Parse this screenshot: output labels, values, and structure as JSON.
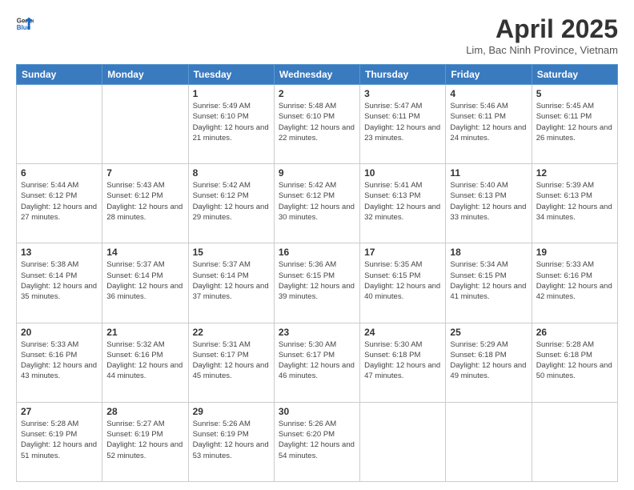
{
  "header": {
    "logo_line1": "General",
    "logo_line2": "Blue",
    "title": "April 2025",
    "subtitle": "Lim, Bac Ninh Province, Vietnam"
  },
  "weekdays": [
    "Sunday",
    "Monday",
    "Tuesday",
    "Wednesday",
    "Thursday",
    "Friday",
    "Saturday"
  ],
  "weeks": [
    [
      null,
      null,
      {
        "day": 1,
        "sunrise": "5:49 AM",
        "sunset": "6:10 PM",
        "daylight": "12 hours and 21 minutes."
      },
      {
        "day": 2,
        "sunrise": "5:48 AM",
        "sunset": "6:10 PM",
        "daylight": "12 hours and 22 minutes."
      },
      {
        "day": 3,
        "sunrise": "5:47 AM",
        "sunset": "6:11 PM",
        "daylight": "12 hours and 23 minutes."
      },
      {
        "day": 4,
        "sunrise": "5:46 AM",
        "sunset": "6:11 PM",
        "daylight": "12 hours and 24 minutes."
      },
      {
        "day": 5,
        "sunrise": "5:45 AM",
        "sunset": "6:11 PM",
        "daylight": "12 hours and 26 minutes."
      }
    ],
    [
      {
        "day": 6,
        "sunrise": "5:44 AM",
        "sunset": "6:12 PM",
        "daylight": "12 hours and 27 minutes."
      },
      {
        "day": 7,
        "sunrise": "5:43 AM",
        "sunset": "6:12 PM",
        "daylight": "12 hours and 28 minutes."
      },
      {
        "day": 8,
        "sunrise": "5:42 AM",
        "sunset": "6:12 PM",
        "daylight": "12 hours and 29 minutes."
      },
      {
        "day": 9,
        "sunrise": "5:42 AM",
        "sunset": "6:12 PM",
        "daylight": "12 hours and 30 minutes."
      },
      {
        "day": 10,
        "sunrise": "5:41 AM",
        "sunset": "6:13 PM",
        "daylight": "12 hours and 32 minutes."
      },
      {
        "day": 11,
        "sunrise": "5:40 AM",
        "sunset": "6:13 PM",
        "daylight": "12 hours and 33 minutes."
      },
      {
        "day": 12,
        "sunrise": "5:39 AM",
        "sunset": "6:13 PM",
        "daylight": "12 hours and 34 minutes."
      }
    ],
    [
      {
        "day": 13,
        "sunrise": "5:38 AM",
        "sunset": "6:14 PM",
        "daylight": "12 hours and 35 minutes."
      },
      {
        "day": 14,
        "sunrise": "5:37 AM",
        "sunset": "6:14 PM",
        "daylight": "12 hours and 36 minutes."
      },
      {
        "day": 15,
        "sunrise": "5:37 AM",
        "sunset": "6:14 PM",
        "daylight": "12 hours and 37 minutes."
      },
      {
        "day": 16,
        "sunrise": "5:36 AM",
        "sunset": "6:15 PM",
        "daylight": "12 hours and 39 minutes."
      },
      {
        "day": 17,
        "sunrise": "5:35 AM",
        "sunset": "6:15 PM",
        "daylight": "12 hours and 40 minutes."
      },
      {
        "day": 18,
        "sunrise": "5:34 AM",
        "sunset": "6:15 PM",
        "daylight": "12 hours and 41 minutes."
      },
      {
        "day": 19,
        "sunrise": "5:33 AM",
        "sunset": "6:16 PM",
        "daylight": "12 hours and 42 minutes."
      }
    ],
    [
      {
        "day": 20,
        "sunrise": "5:33 AM",
        "sunset": "6:16 PM",
        "daylight": "12 hours and 43 minutes."
      },
      {
        "day": 21,
        "sunrise": "5:32 AM",
        "sunset": "6:16 PM",
        "daylight": "12 hours and 44 minutes."
      },
      {
        "day": 22,
        "sunrise": "5:31 AM",
        "sunset": "6:17 PM",
        "daylight": "12 hours and 45 minutes."
      },
      {
        "day": 23,
        "sunrise": "5:30 AM",
        "sunset": "6:17 PM",
        "daylight": "12 hours and 46 minutes."
      },
      {
        "day": 24,
        "sunrise": "5:30 AM",
        "sunset": "6:18 PM",
        "daylight": "12 hours and 47 minutes."
      },
      {
        "day": 25,
        "sunrise": "5:29 AM",
        "sunset": "6:18 PM",
        "daylight": "12 hours and 49 minutes."
      },
      {
        "day": 26,
        "sunrise": "5:28 AM",
        "sunset": "6:18 PM",
        "daylight": "12 hours and 50 minutes."
      }
    ],
    [
      {
        "day": 27,
        "sunrise": "5:28 AM",
        "sunset": "6:19 PM",
        "daylight": "12 hours and 51 minutes."
      },
      {
        "day": 28,
        "sunrise": "5:27 AM",
        "sunset": "6:19 PM",
        "daylight": "12 hours and 52 minutes."
      },
      {
        "day": 29,
        "sunrise": "5:26 AM",
        "sunset": "6:19 PM",
        "daylight": "12 hours and 53 minutes."
      },
      {
        "day": 30,
        "sunrise": "5:26 AM",
        "sunset": "6:20 PM",
        "daylight": "12 hours and 54 minutes."
      },
      null,
      null,
      null
    ]
  ]
}
